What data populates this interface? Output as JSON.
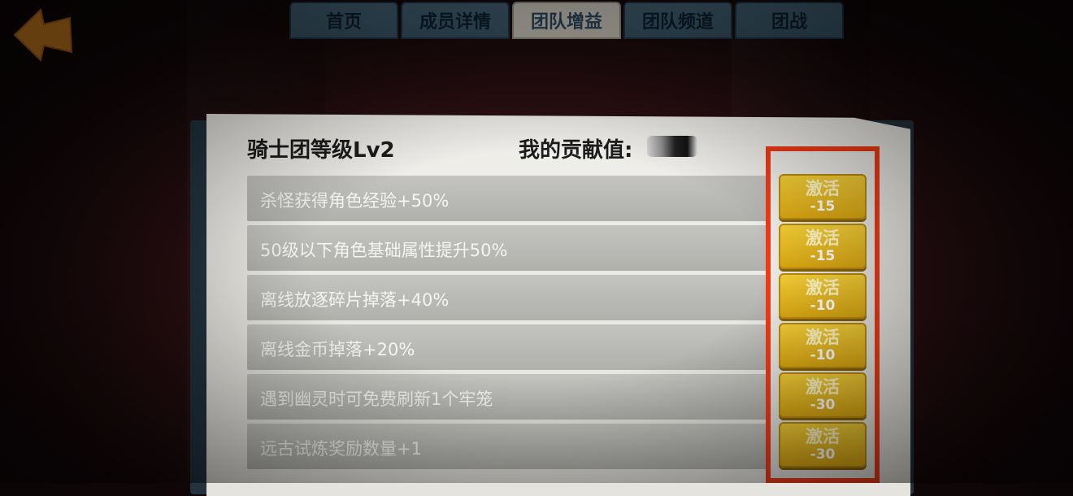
{
  "tabs": [
    {
      "label": "首页",
      "active": false
    },
    {
      "label": "成员详情",
      "active": false
    },
    {
      "label": "团队增益",
      "active": true
    },
    {
      "label": "团队频道",
      "active": false
    },
    {
      "label": "团战",
      "active": false
    }
  ],
  "panel": {
    "guild_level": "骑士团等级Lv2",
    "contribution_label": "我的贡献值:"
  },
  "buffs": [
    {
      "text": "杀怪获得角色经验+50%",
      "button": "激活",
      "cost": "-15"
    },
    {
      "text": "50级以下角色基础属性提升50%",
      "button": "激活",
      "cost": "-15"
    },
    {
      "text": "离线放逐碎片掉落+40%",
      "button": "激活",
      "cost": "-10"
    },
    {
      "text": "离线金币掉落+20%",
      "button": "激活",
      "cost": "-10"
    },
    {
      "text": "遇到幽灵时可免费刷新1个牢笼",
      "button": "激活",
      "cost": "-30"
    },
    {
      "text": "远古试炼奖励数量+1",
      "button": "激活",
      "cost": "-30"
    }
  ],
  "colors": {
    "highlight": "#f03a17",
    "button": "#f4cf37",
    "tab_active": "#e7e3d8",
    "tab_inactive": "#4a6d82"
  },
  "icons": {
    "back": "back-arrow-icon"
  }
}
